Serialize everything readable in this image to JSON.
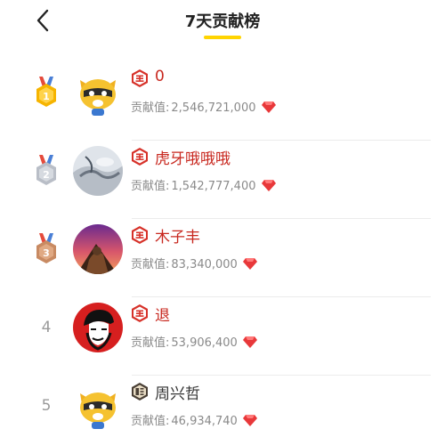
{
  "header": {
    "title": "7天贡献榜"
  },
  "contribution_label": "贡献值:",
  "colors": {
    "accent": "#ffd400",
    "name_red": "#c8281f",
    "diamond": "#e8383a"
  },
  "rows": [
    {
      "rank": "1",
      "medal": "gold",
      "name": "0",
      "value": "2,546,721,000",
      "badge": "wang-badge-icon"
    },
    {
      "rank": "2",
      "medal": "silver",
      "name": "虎牙哦哦哦",
      "value": "1,542,777,400",
      "badge": "wang-badge-icon"
    },
    {
      "rank": "3",
      "medal": "bronze",
      "name": "木子丰",
      "value": "83,340,000",
      "badge": "wang-badge-icon"
    },
    {
      "rank": "4",
      "medal": "",
      "name": "退",
      "value": "53,906,400",
      "badge": "wang-badge-icon"
    },
    {
      "rank": "5",
      "medal": "",
      "name": "周兴哲",
      "value": "46,934,740",
      "badge": "qi-badge-icon"
    }
  ]
}
